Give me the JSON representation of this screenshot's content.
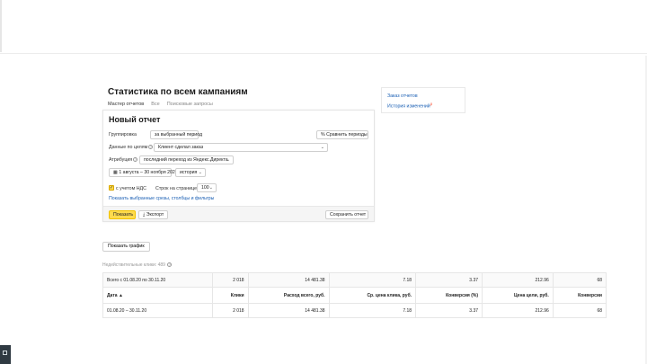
{
  "page": {
    "title": "Статистика по всем кампаниям",
    "tabs": [
      {
        "label": "Мастер отчетов",
        "active": true
      },
      {
        "label": "Все",
        "active": false
      },
      {
        "label": "Поисковые запросы",
        "active": false
      }
    ]
  },
  "report": {
    "title": "Новый отчет",
    "grouping_label": "Группировка",
    "grouping_value": "за выбранный период",
    "compare_button": "Сравнить периоды",
    "goals_label": "Данные по целям",
    "goals_value": "Клиент сделал заказ",
    "attribution_label": "Атрибуция",
    "attribution_value": "последний переход из Яндекс.Директа",
    "date_range": "1 августа – 30 ноября 2020",
    "history_value": "история",
    "vat_label": "с учетом НДС",
    "rows_per_page_label": "Строк на странице",
    "rows_per_page_value": "100",
    "show_filters_link": "Показать выбранные срезы, столбцы и фильтры",
    "show_button": "Показать",
    "export_button": "Экспорт",
    "save_button": "Сохранить отчет"
  },
  "sidebar": {
    "order_reports": "Заказ отчетов",
    "change_history": "История изменений",
    "change_history_sup": "β"
  },
  "results": {
    "show_graph_button": "Показать график",
    "invalid_clicks": "Недействительные клики: 489",
    "total_row": {
      "label": "Всего с 01.08.20 по 30.11.20",
      "clicks": "2 018",
      "spend": "14 481.38",
      "avg_cpc": "7.18",
      "conversion": "3.37",
      "cpa": "212.96",
      "conversions": "68"
    },
    "columns": [
      "Дата ▲",
      "Клики",
      "Расход всего, руб.",
      "Ср. цена клика, руб.",
      "Конверсия (%)",
      "Цена цели, руб.",
      "Конверсии"
    ],
    "rows": [
      {
        "date": "01.08.20 – 30.11.20",
        "clicks": "2 018",
        "spend": "14 481.38",
        "avg_cpc": "7.18",
        "conversion": "3.37",
        "cpa": "212.96",
        "conversions": "68"
      }
    ]
  },
  "colors": {
    "accent_yellow": "#ffdb4d",
    "active_tab_underline": "#fc3f1d",
    "link_blue": "#1a5fb4"
  }
}
